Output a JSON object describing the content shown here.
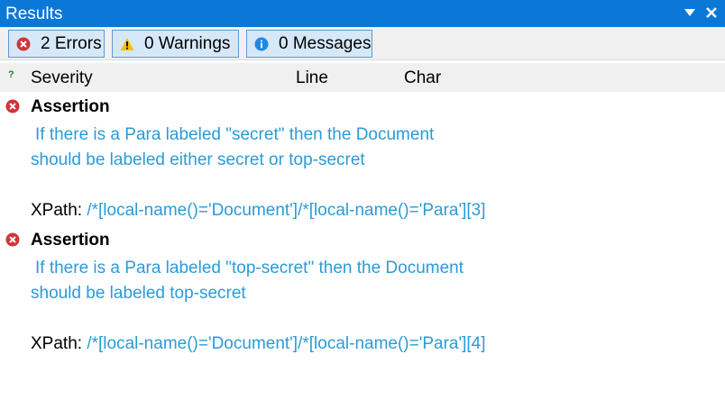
{
  "window": {
    "title": "Results"
  },
  "filters": {
    "errors_label": "2 Errors",
    "warnings_label": "0 Warnings",
    "messages_label": "0 Messages"
  },
  "columns": {
    "help_glyph": "?",
    "severity": "Severity",
    "line": "Line",
    "char": "Char"
  },
  "results": [
    {
      "type": "Assertion",
      "message_line1": "If there is a Para labeled \"secret\" then the Document",
      "message_line2": "should be labeled either secret or top-secret",
      "xpath_label": "XPath:",
      "xpath": "/*[local-name()='Document']/*[local-name()='Para'][3]",
      "severity_icon": "error-icon"
    },
    {
      "type": "Assertion",
      "message_line1": "If there is a Para labeled \"top-secret\" then the Document",
      "message_line2": "should be labeled top-secret",
      "xpath_label": "XPath:",
      "xpath": "/*[local-name()='Document']/*[local-name()='Para'][4]",
      "severity_icon": "error-icon"
    }
  ],
  "colors": {
    "titlebar": "#0b78d7",
    "filter_button_bg": "#d6e8f8",
    "filter_button_border": "#5a9bd5",
    "error_red": "#d13438",
    "link_blue": "#2a9bd8"
  }
}
